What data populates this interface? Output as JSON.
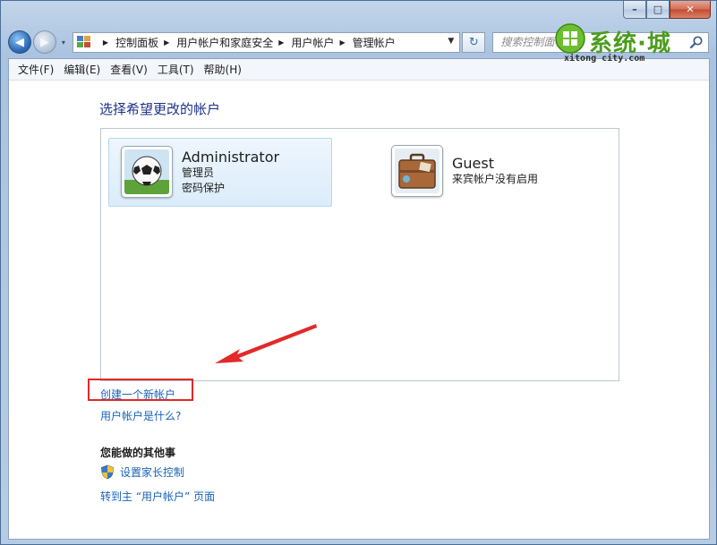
{
  "window": {
    "minimize_label": "–",
    "maximize_label": "□",
    "close_label": "✕"
  },
  "navigation": {
    "back_icon": "◀",
    "forward_icon": "▶",
    "history_icon": "▾",
    "breadcrumbs": [
      "控制面板",
      "用户帐户和家庭安全",
      "用户帐户",
      "管理帐户"
    ],
    "separator": "▶",
    "dropdown_icon": "▼",
    "refresh_icon": "↻",
    "search_placeholder": "搜索控制面板"
  },
  "menu": {
    "items": [
      "文件(F)",
      "编辑(E)",
      "查看(V)",
      "工具(T)",
      "帮助(H)"
    ]
  },
  "main": {
    "heading": "选择希望更改的帐户",
    "accounts": [
      {
        "name": "Administrator",
        "role": "管理员",
        "status": "密码保护",
        "picture": "soccer-ball-icon"
      },
      {
        "name": "Guest",
        "status": "来宾帐户没有启用",
        "picture": "suitcase-icon"
      }
    ],
    "create_link": "创建一个新帐户",
    "what_link": "用户帐户是什么?",
    "tasks_title": "您能做的其他事",
    "parental_link": "设置家长控制",
    "goto_link": "转到主 “用户帐户” 页面"
  },
  "watermark": {
    "chinese": "系统·城",
    "english": "xitong city.com"
  },
  "colors": {
    "link": "#1863b8",
    "heading": "#1e3287",
    "highlight_box": "#e2282b",
    "watermark_green": "#4c9d1d"
  }
}
